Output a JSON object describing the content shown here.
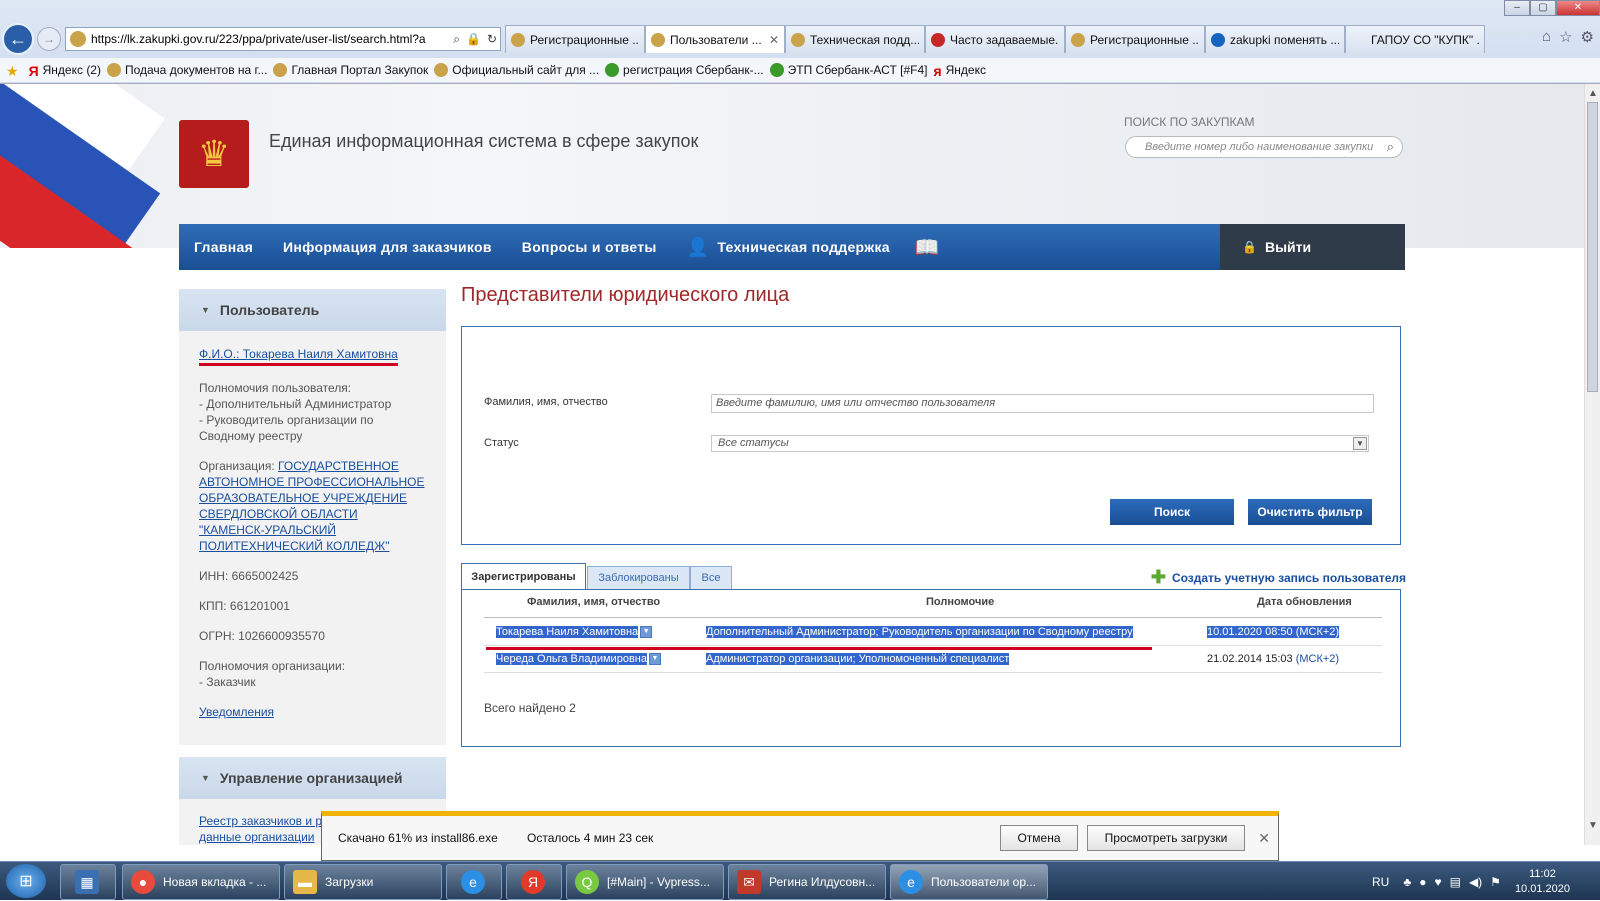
{
  "browser": {
    "url": "https://lk.zakupki.gov.ru/223/ppa/private/user-list/search.html?a",
    "tabs": [
      {
        "label": "Регистрационные ...",
        "active": false,
        "icon": "emblem"
      },
      {
        "label": "Пользователи ...",
        "active": true,
        "icon": "emblem"
      },
      {
        "label": "Техническая подд...",
        "active": false,
        "icon": "emblem"
      },
      {
        "label": "Часто задаваемые...",
        "active": false,
        "icon": "red"
      },
      {
        "label": "Регистрационные ...",
        "active": false,
        "icon": "emblem"
      },
      {
        "label": "zakupki поменять ...",
        "active": false,
        "icon": "blue"
      },
      {
        "label": "ГАПОУ СО \"КУПК\" ...",
        "active": false,
        "icon": "none"
      }
    ],
    "favorites": [
      {
        "label": "Яндекс (2)",
        "icon": "y"
      },
      {
        "label": "Подача документов на г...",
        "icon": "emblem"
      },
      {
        "label": "Главная Портал Закупок",
        "icon": "emblem"
      },
      {
        "label": "Официальный сайт для ...",
        "icon": "emblem"
      },
      {
        "label": "регистрация Сбербанк-...",
        "icon": "g"
      },
      {
        "label": "ЭТП Сбербанк-АСТ [#F4]",
        "icon": "g"
      },
      {
        "label": "Яндекс",
        "icon": "y"
      }
    ]
  },
  "site": {
    "title": "Единая информационная система в сфере закупок",
    "search_label": "ПОИСК ПО ЗАКУПКАМ",
    "search_placeholder": "Введите номер либо наименование закупки",
    "nav": {
      "home": "Главная",
      "info": "Информация для заказчиков",
      "qa": "Вопросы и ответы",
      "support": "Техническая поддержка",
      "logout": "Выйти"
    }
  },
  "sidebar": {
    "user_header": "Пользователь",
    "fio": "Ф.И.О.: Токарева Наиля Хамитовна",
    "powers_label": "Полномочия пользователя:",
    "powers": [
      "- Дополнительный Администратор",
      "- Руководитель организации по Сводному реестру"
    ],
    "org_label": "Организация: ",
    "org_name": "ГОСУДАРСТВЕННОЕ АВТОНОМНОЕ ПРОФЕССИОНАЛЬНОЕ ОБРАЗОВАТЕЛЬНОЕ УЧРЕЖДЕНИЕ СВЕРДЛОВСКОЙ ОБЛАСТИ \"КАМЕНСК-УРАЛЬСКИЙ ПОЛИТЕХНИЧЕСКИЙ КОЛЛЕДЖ\"",
    "inn": "ИНН: 6665002425",
    "kpp": "КПП: 661201001",
    "ogrn": "ОГРН: 1026600935570",
    "org_powers_label": "Полномочия организации:",
    "org_powers": "- Заказчик",
    "notifications": "Уведомления",
    "org_mgmt_header": "Управление организацией",
    "org_mgmt_link1": "Реестр заказчиков и р",
    "org_mgmt_link2": "данные организации"
  },
  "main": {
    "title": "Представители юридического лица",
    "filter": {
      "fio_label": "Фамилия, имя, отчество",
      "fio_placeholder": "Введите фамилию, имя или отчество пользователя",
      "status_label": "Статус",
      "status_value": "Все статусы",
      "search_button": "Поиск",
      "clear_button": "Очистить фильтр"
    },
    "tabs": [
      "Зарегистрированы",
      "Заблокированы",
      "Все"
    ],
    "create_link": "Создать учетную запись пользователя",
    "columns": [
      "Фамилия, имя, отчество",
      "Полномочие",
      "Дата обновления"
    ],
    "rows": [
      {
        "name": "Токарева Наиля Хамитовна",
        "role": "Дополнительный Администратор; Руководитель организации по Сводному реестру",
        "date": "10.01.2020 08:50 (МСК+2)"
      },
      {
        "name": "Череда Ольга Владимировна",
        "role": "Администратор организации; Уполномоченный специалист",
        "date": "21.02.2014 15:03 ",
        "tz": "(МСК+2)"
      }
    ],
    "total": "Всего найдено 2"
  },
  "download": {
    "status": "Скачано 61% из install86.exe",
    "progress_percent": 61,
    "remaining": "Осталось  4 мин 23 сек",
    "cancel": "Отмена",
    "view": "Просмотреть загрузки"
  },
  "taskbar": {
    "items": [
      {
        "label": "Новая вкладка - ...",
        "color": "#e84a3c",
        "active": false
      },
      {
        "label": "Загрузки",
        "color": "#e6b84a",
        "active": false
      },
      {
        "label": "",
        "color": "#2b8fe6",
        "active": false
      },
      {
        "label": "",
        "color": "#e23a2a",
        "active": false
      },
      {
        "label": "[#Main] - Vypress...",
        "color": "#7ac943",
        "active": false
      },
      {
        "label": "Регина Илдусовн...",
        "color": "#c0392b",
        "active": false
      },
      {
        "label": "Пользователи ор...",
        "color": "#2b8fe6",
        "active": true
      }
    ],
    "lang": "RU",
    "time": "11:02",
    "date": "10.01.2020"
  }
}
